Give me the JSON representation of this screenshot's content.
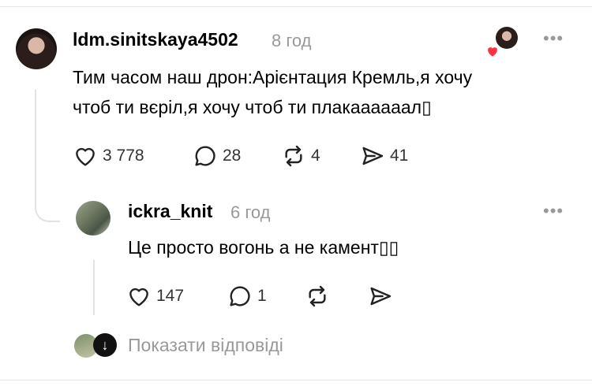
{
  "post": {
    "username": "ldm.sinitskaya4502",
    "time": "8 год",
    "text_line1": "Тим часом наш дрон:Арієнтация Кремль,я хочу",
    "text_line2": "чтоб ти вєріл,я хочу чтоб ти плакаааааал▯",
    "actions": {
      "likes": "3 778",
      "comments": "28",
      "reposts": "4",
      "shares": "41"
    },
    "more": "•••"
  },
  "reply": {
    "username": "ickra_knit",
    "time": "6 год",
    "text": "Це просто вогонь а не камент▯▯",
    "actions": {
      "likes": "147",
      "comments": "1"
    },
    "more": "•••"
  },
  "show_replies_label": "Показати відповіді",
  "colors": {
    "muted": "#999999",
    "heart": "#ff3040"
  }
}
